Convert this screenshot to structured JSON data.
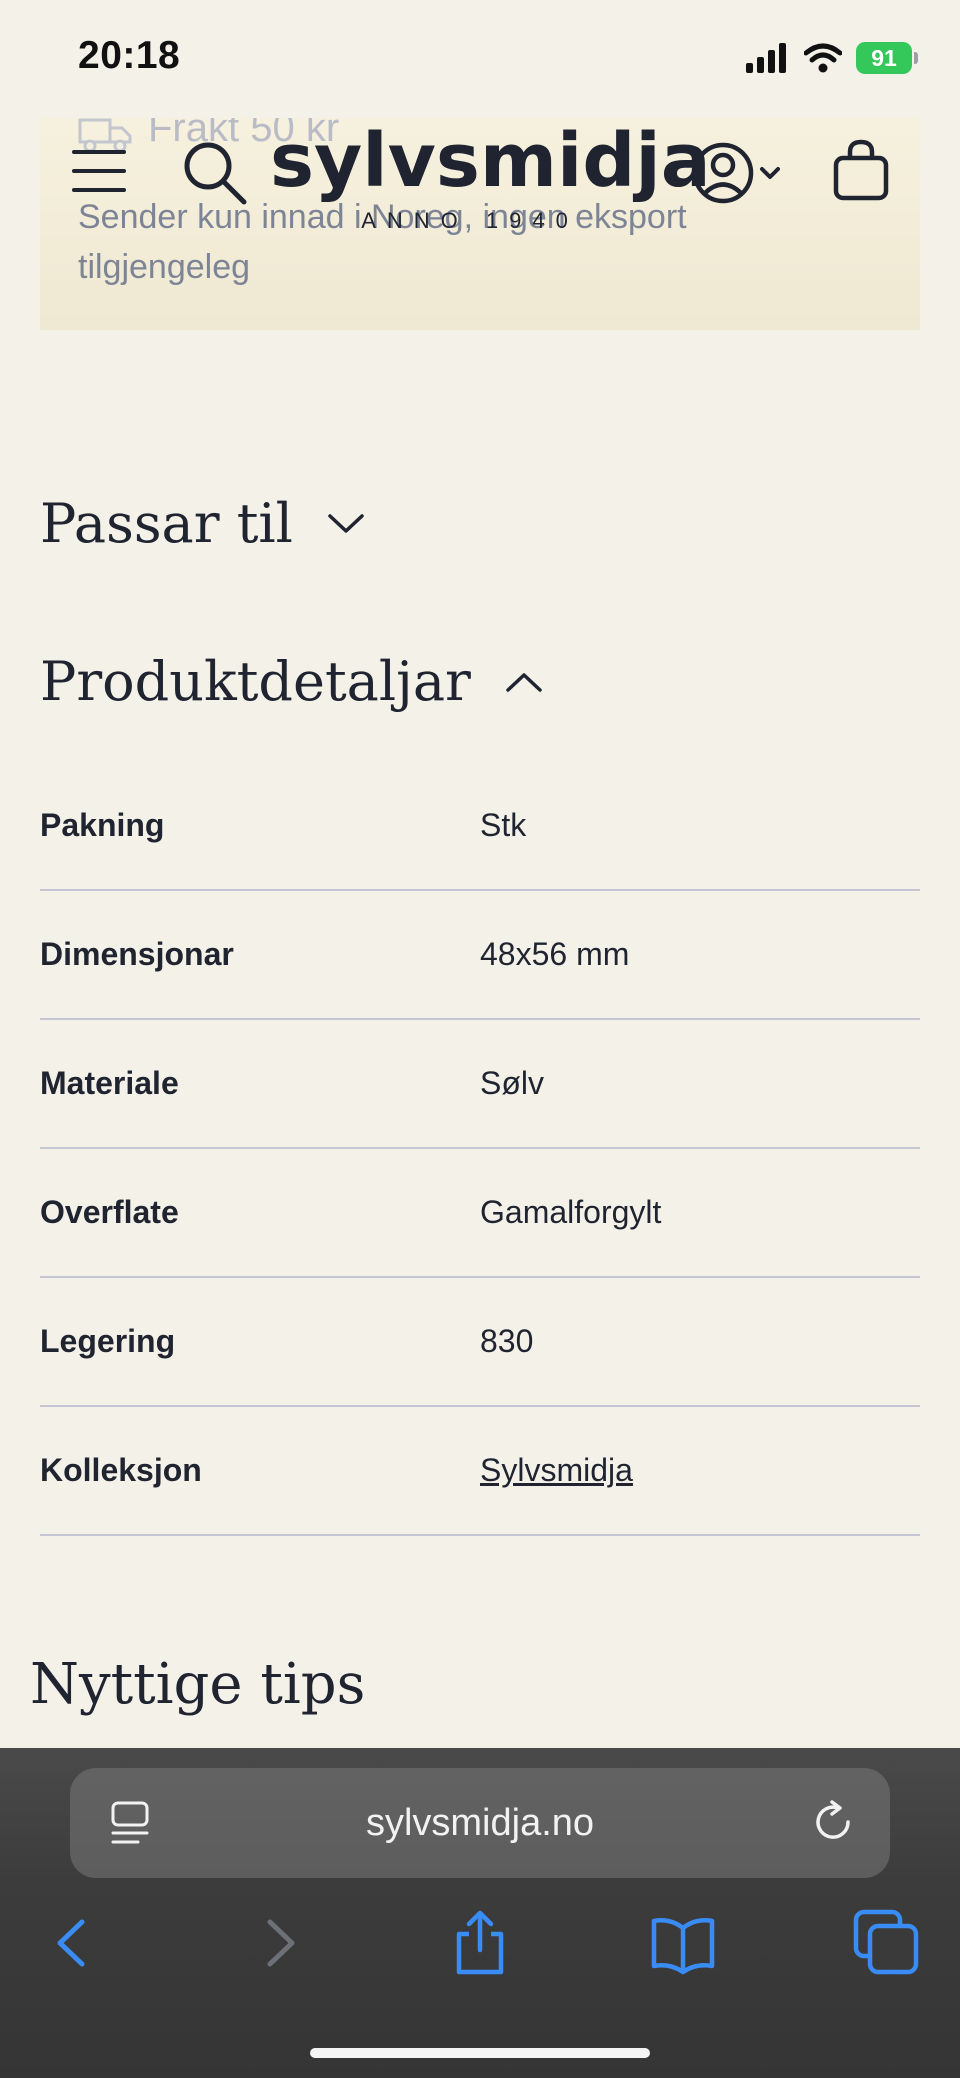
{
  "status_bar": {
    "time": "20:18",
    "battery": "91",
    "icons": [
      "cellular-signal-icon",
      "wifi-icon",
      "battery-icon"
    ]
  },
  "promo": {
    "title": "Frakt 50 kr",
    "text": "Sender kun innad i Noreg, ingen eksport tilgjengeleg",
    "icon": "truck-icon"
  },
  "header": {
    "logo_name": "sylvsmidja",
    "logo_sub": "ANNO 1940",
    "icons": [
      "menu-icon",
      "search-icon",
      "account-icon",
      "cart-icon"
    ]
  },
  "accordions": {
    "fits": {
      "title": "Passar til",
      "state": "collapsed"
    },
    "details": {
      "title": "Produktdetaljar",
      "state": "expanded"
    }
  },
  "details": [
    {
      "label": "Pakning",
      "value": "Stk"
    },
    {
      "label": "Dimensjonar",
      "value": "48x56 mm"
    },
    {
      "label": "Materiale",
      "value": "Sølv"
    },
    {
      "label": "Overflate",
      "value": "Gamalforgylt"
    },
    {
      "label": "Legering",
      "value": "830"
    },
    {
      "label": "Kolleksjon",
      "value": "Sylvsmidja"
    }
  ],
  "tips": {
    "title": "Nyttige tips"
  },
  "browser": {
    "url": "sylvsmidja.no",
    "toolbar": [
      "back-icon",
      "forward-icon",
      "share-icon",
      "bookmarks-icon",
      "tabs-icon"
    ],
    "accent": "#3a8cf5"
  }
}
